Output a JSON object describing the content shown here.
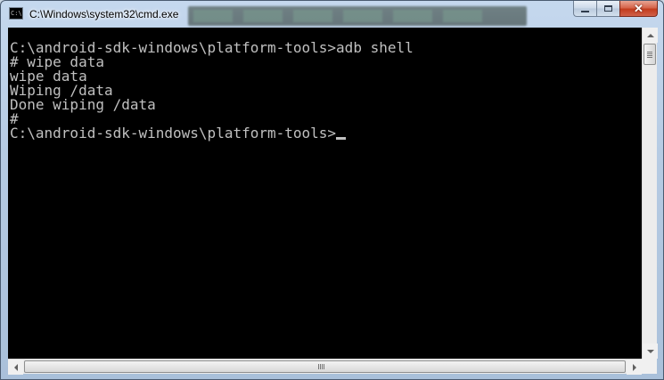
{
  "window": {
    "title": "C:\\Windows\\system32\\cmd.exe",
    "icon_label": "C:\\",
    "close_glyph": "✕"
  },
  "console": {
    "lines": [
      "",
      "C:\\android-sdk-windows\\platform-tools>adb shell",
      "# wipe data",
      "wipe data",
      "Wiping /data",
      "Done wiping /data",
      "#",
      "C:\\android-sdk-windows\\platform-tools>"
    ],
    "text_color": "#c0c0c0",
    "background_color": "#000000"
  },
  "icons": {
    "app": "cmd-console-icon",
    "minimize": "minimize-icon",
    "maximize": "maximize-icon",
    "close": "close-icon"
  }
}
